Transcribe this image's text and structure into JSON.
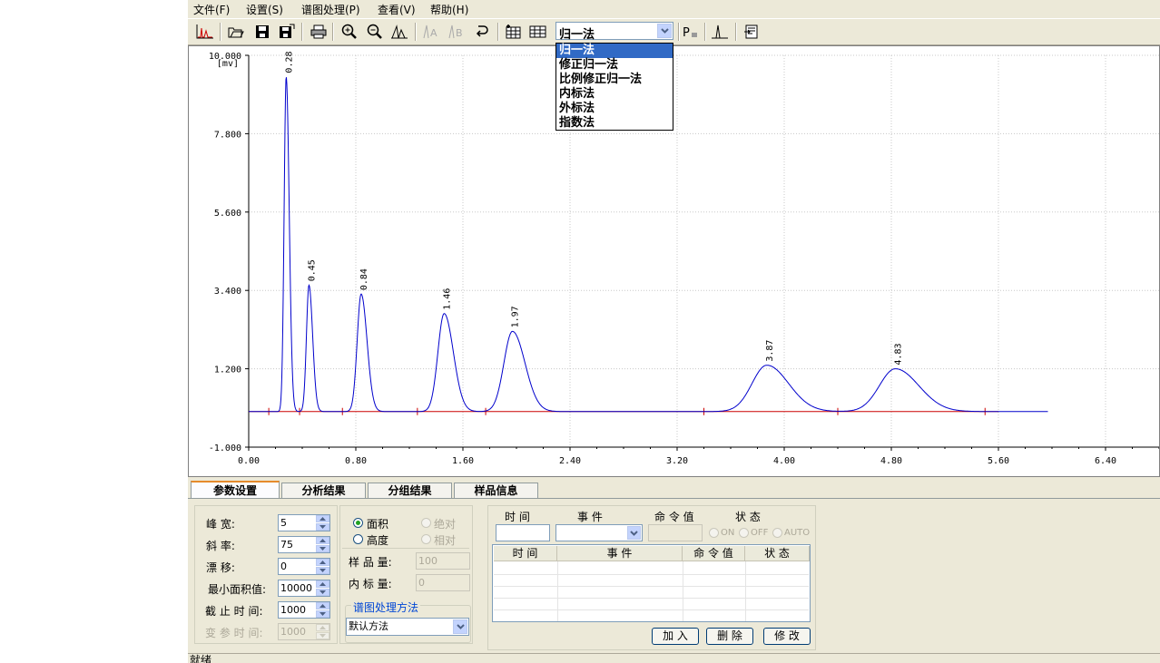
{
  "menu": {
    "items": [
      "文件(F)",
      "设置(S)",
      "谱图处理(P)",
      "查看(V)",
      "帮助(H)"
    ]
  },
  "toolbar": {
    "icons": [
      "chromatogram-icon",
      "open-folder-icon",
      "save-icon",
      "save-as-icon",
      "print-icon",
      "zoom-in-icon",
      "zoom-out-icon",
      "peak-icon",
      "label-a-icon",
      "label-b-icon",
      "undo-icon",
      "clipboard-table-icon",
      "table-icon",
      "p-icon",
      "peak-single-icon",
      "export-icon"
    ],
    "method_selected": "归一法",
    "method_options": [
      "归一法",
      "修正归一法",
      "比例修正归一法",
      "内标法",
      "外标法",
      "指数法"
    ]
  },
  "chart_data": {
    "type": "line",
    "title": "",
    "xlabel": "",
    "ylabel": "[mv]",
    "xlim": [
      0,
      6.8
    ],
    "ylim": [
      -1.0,
      10.0
    ],
    "x_ticks": [
      "0.00",
      "0.80",
      "1.60",
      "2.40",
      "3.20",
      "4.00",
      "4.80",
      "5.60",
      "6.40"
    ],
    "y_ticks": [
      "10.000",
      "7.800",
      "5.600",
      "3.400",
      "1.200",
      "-1.000"
    ],
    "grid": true,
    "baseline": 0.0,
    "series": [
      {
        "color": "#0000cc",
        "peaks": [
          {
            "rt": 0.28,
            "label": "0.28",
            "height": 9.4,
            "sigma": 0.018
          },
          {
            "rt": 0.45,
            "label": "0.45",
            "height": 3.55,
            "sigma": 0.022
          },
          {
            "rt": 0.84,
            "label": "0.84",
            "height": 3.3,
            "sigma": 0.035
          },
          {
            "rt": 1.46,
            "label": "1.46",
            "height": 2.75,
            "sigma": 0.055
          },
          {
            "rt": 1.97,
            "label": "1.97",
            "height": 2.25,
            "sigma": 0.075
          },
          {
            "rt": 3.87,
            "label": "3.87",
            "height": 1.3,
            "sigma": 0.13
          },
          {
            "rt": 4.83,
            "label": "4.83",
            "height": 1.2,
            "sigma": 0.14
          }
        ],
        "x_end": 5.97
      }
    ],
    "baseline_color": "#cc0000",
    "baseline_x": [
      0.0,
      5.6
    ],
    "baseline_marks": [
      0.15,
      0.38,
      0.7,
      1.26,
      1.77,
      3.4,
      4.4,
      5.5
    ]
  },
  "tabs": [
    "参数设置",
    "分析结果",
    "分组结果",
    "样品信息"
  ],
  "params": {
    "peak_width_label": "峰    宽:",
    "peak_width": "5",
    "slope_label": "斜    率:",
    "slope": "75",
    "drift_label": "漂    移:",
    "drift": "0",
    "min_area_label": "最小面积值:",
    "min_area": "10000",
    "stop_time_label": "截 止 时 间:",
    "stop_time": "1000",
    "var_time_label": "变 参 时 间:",
    "var_time": "1000"
  },
  "calc": {
    "area_label": "面积",
    "height_label": "高度",
    "absolute_label": "绝对",
    "relative_label": "相对",
    "sample_amount_label": "样 品 量:",
    "sample_amount": "100",
    "istd_amount_label": "内 标 量:",
    "istd_amount": "0",
    "proc_method_title": "谱图处理方法",
    "proc_method": "默认方法"
  },
  "events": {
    "time_label": "时  间",
    "event_label": "事  件",
    "command_label": "命 令 值",
    "status_label": "状  态",
    "on_label": "ON",
    "off_label": "OFF",
    "auto_label": "AUTO",
    "table_headers": [
      "时  间",
      "事    件",
      "命 令 值",
      "状   态"
    ],
    "add_button": "加 入",
    "delete_button": "删 除",
    "modify_button": "修 改"
  },
  "status": {
    "text": "就绪"
  }
}
